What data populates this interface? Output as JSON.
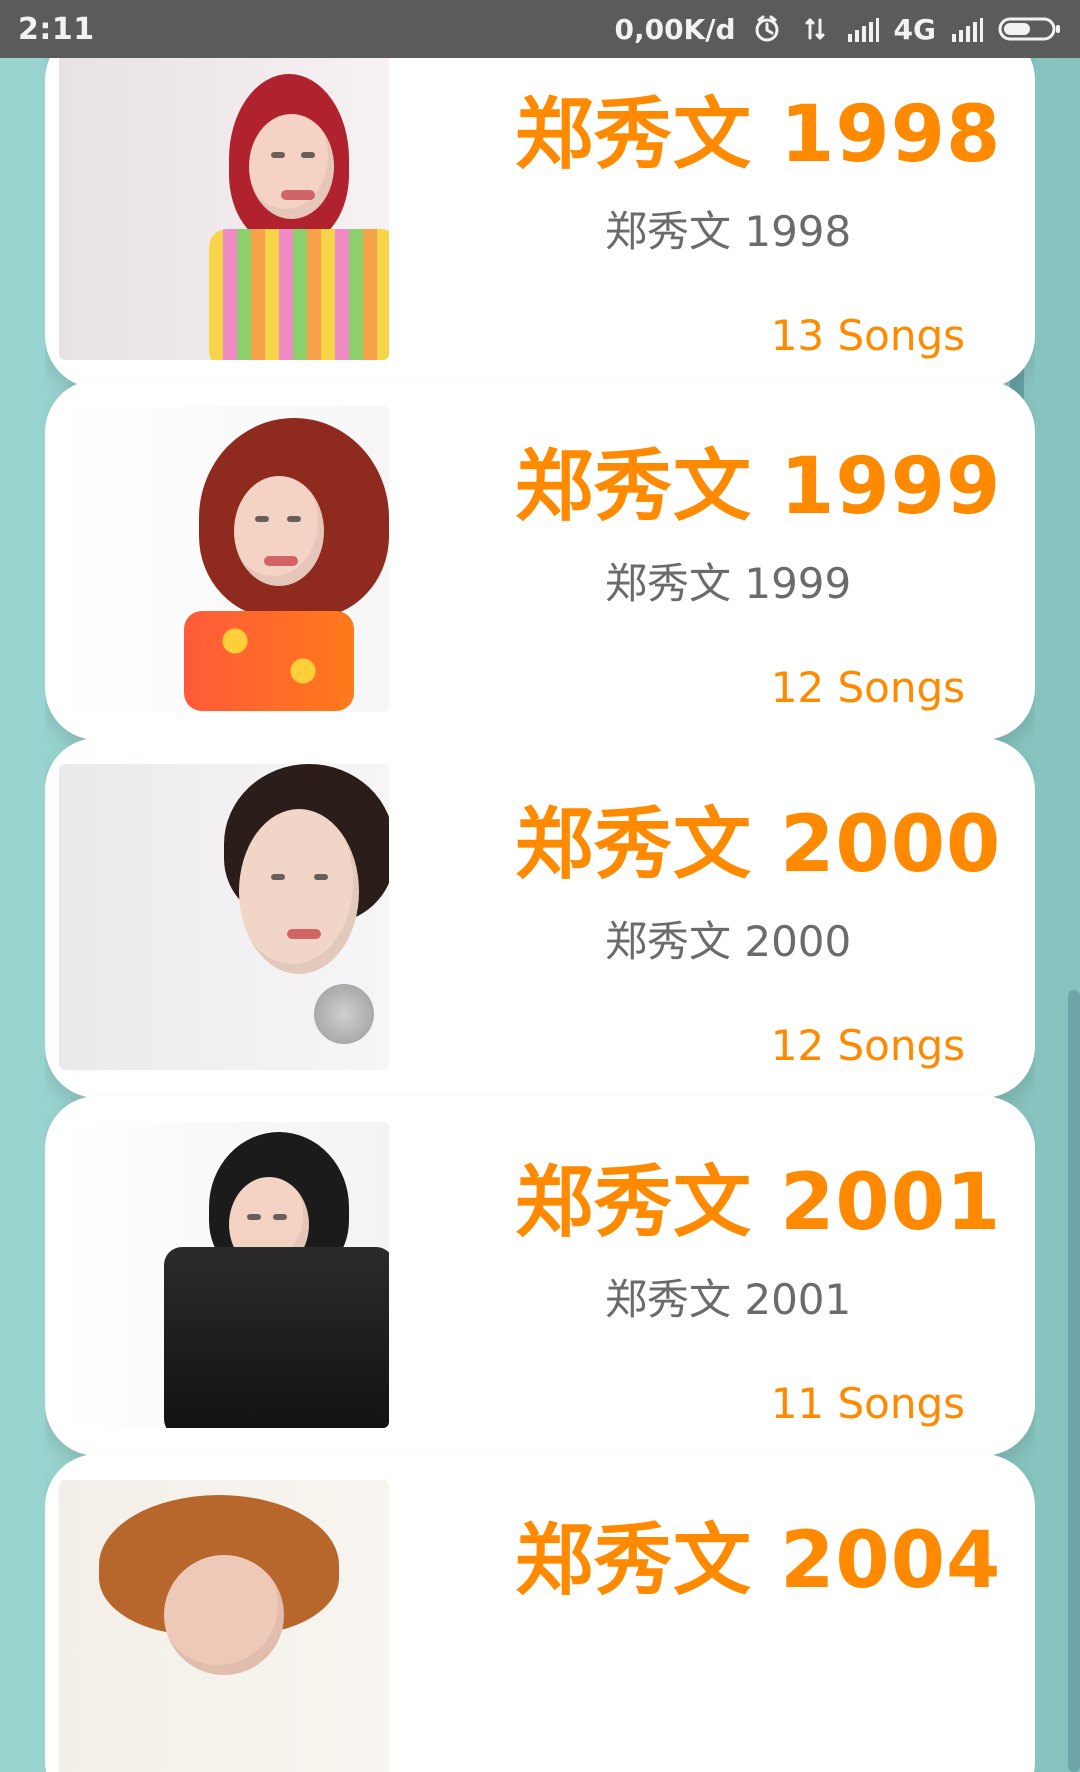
{
  "status_bar": {
    "time": "2:11",
    "network_speed": "0,00K/d",
    "network_type": "4G",
    "icons": [
      "alarm-icon",
      "data-transfer-icon",
      "signal-icon",
      "signal-icon",
      "battery-icon"
    ]
  },
  "albums": [
    {
      "title": "郑秀文 1998",
      "subtitle": "郑秀文 1998",
      "songs": "13 Songs"
    },
    {
      "title": "郑秀文 1999",
      "subtitle": "郑秀文 1999",
      "songs": "12 Songs"
    },
    {
      "title": "郑秀文 2000",
      "subtitle": "郑秀文 2000",
      "songs": "12 Songs"
    },
    {
      "title": "郑秀文 2001",
      "subtitle": "郑秀文 2001",
      "songs": "11 Songs"
    },
    {
      "title": "郑秀文 2004",
      "subtitle": "",
      "songs": ""
    }
  ],
  "colors": {
    "accent": "#ff8a00",
    "status_bar": "#5b5b5b",
    "card": "#ffffff",
    "background": "#8fcfca",
    "subtitle": "#6b6b6b"
  }
}
